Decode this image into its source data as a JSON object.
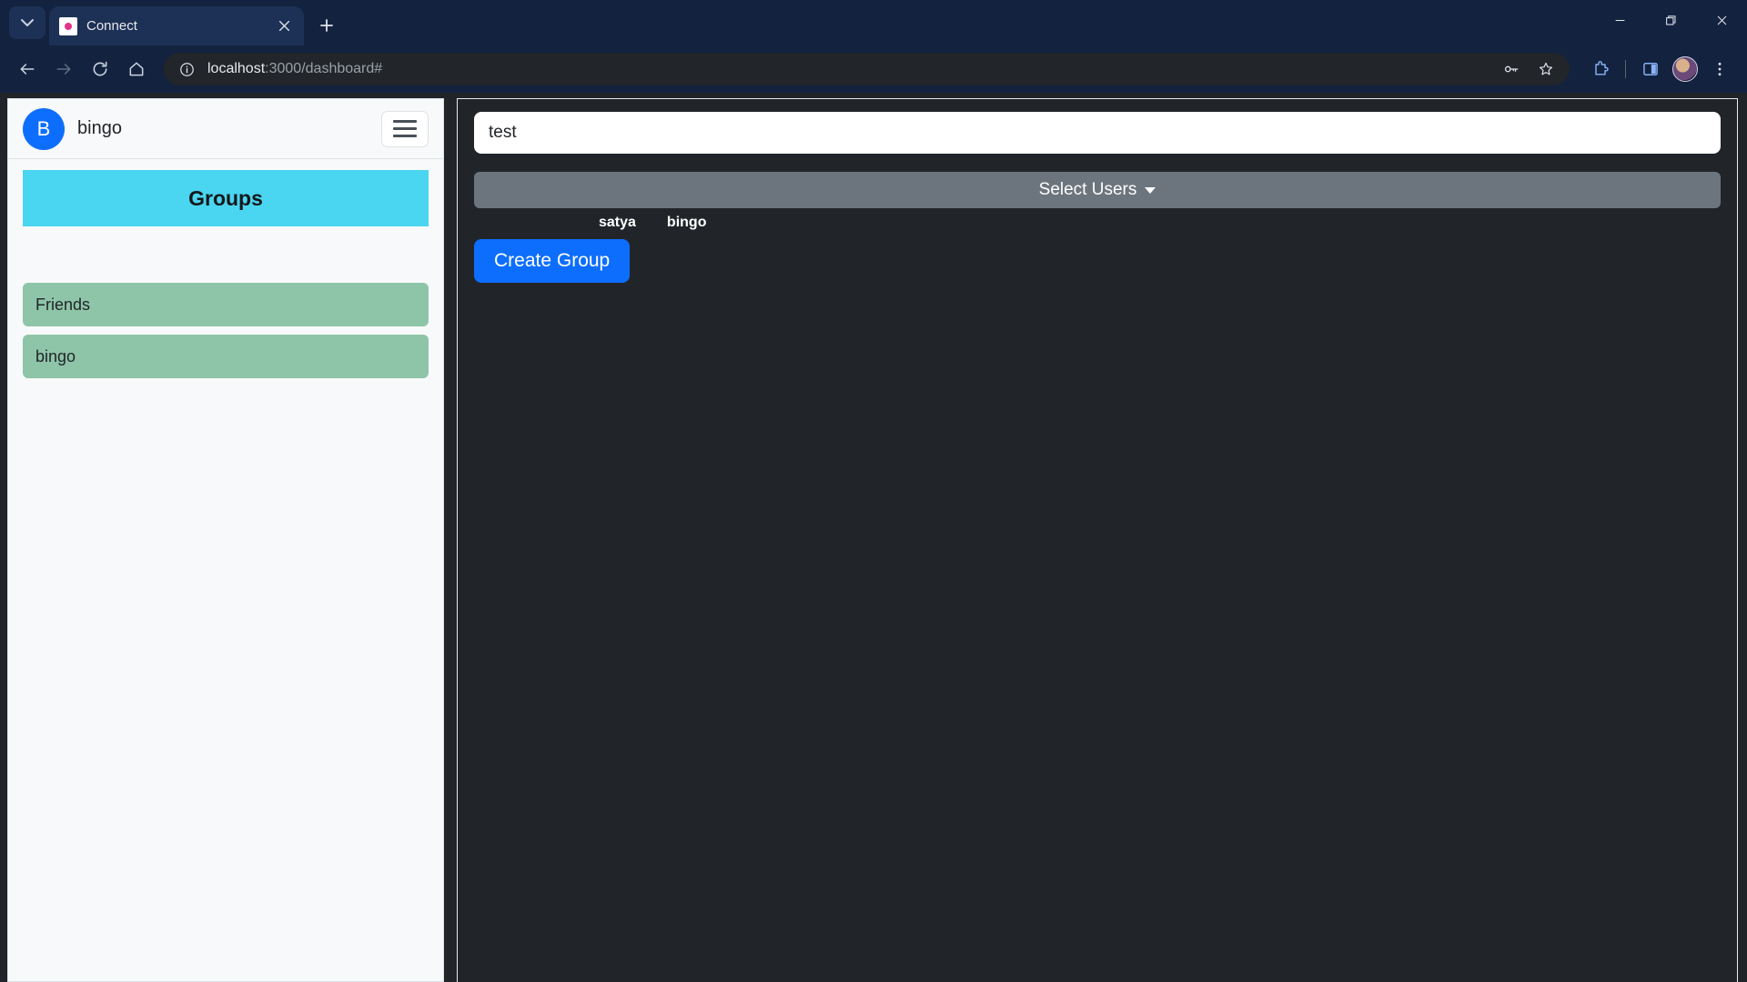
{
  "browser": {
    "tab": {
      "title": "Connect",
      "favicon_icon": "connect-favicon"
    },
    "tab_search_icon": "chevron-down-icon",
    "new_tab_icon": "plus-icon",
    "tab_close_icon": "close-icon",
    "nav": {
      "back_icon": "arrow-left-icon",
      "forward_icon": "arrow-right-icon",
      "reload_icon": "reload-icon",
      "home_icon": "home-icon"
    },
    "omnibox": {
      "info_icon": "info-circle-icon",
      "url_host": "localhost",
      "url_rest": ":3000/dashboard#",
      "password_icon": "key-icon",
      "bookmark_icon": "star-icon"
    },
    "toolbar_right": {
      "extensions_icon": "puzzle-piece-icon",
      "side_panel_icon": "side-panel-icon",
      "profile_icon": "profile-avatar",
      "menu_icon": "three-dot-menu-icon"
    },
    "window_controls": {
      "minimize_icon": "minimize-icon",
      "maximize_icon": "restore-icon",
      "close_icon": "window-close-icon"
    }
  },
  "sidebar": {
    "avatar_initial": "B",
    "username": "bingo",
    "menu_button_icon": "hamburger-icon",
    "groups_header": "Groups",
    "groups": [
      {
        "label": "Friends"
      },
      {
        "label": "bingo"
      }
    ]
  },
  "main": {
    "group_name_value": "test",
    "group_name_placeholder": "",
    "select_users_label": "Select Users",
    "selected_users": [
      {
        "name": "satya"
      },
      {
        "name": "bingo"
      }
    ],
    "create_group_label": "Create Group"
  },
  "colors": {
    "browser_chrome": "#13223f",
    "page_background": "#212529",
    "sidebar_background": "#f8f9fa",
    "accent_blue": "#0d6efd",
    "groups_header_cyan": "#4ad5f0",
    "group_item_green": "#8ec5a8",
    "select_users_gray": "#6c757d"
  }
}
